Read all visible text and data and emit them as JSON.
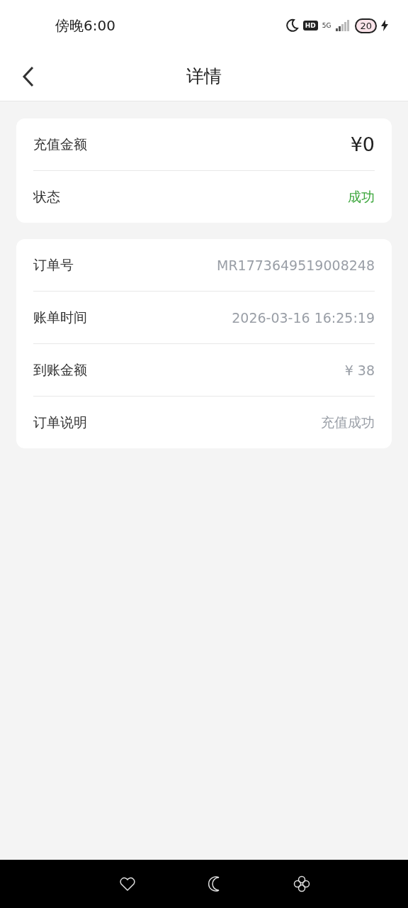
{
  "status_bar": {
    "time": "傍晚6:00",
    "hd": "HD",
    "network": "5G",
    "battery": "20",
    "charging": true
  },
  "header": {
    "title": "详情"
  },
  "cards": [
    {
      "rows": [
        {
          "label": "充值金额",
          "value": "¥0",
          "kind": "amount"
        },
        {
          "label": "状态",
          "value": "成功",
          "kind": "status"
        }
      ]
    },
    {
      "rows": [
        {
          "label": "订单号",
          "value": "MR1773649519008248",
          "kind": "plain"
        },
        {
          "label": "账单时间",
          "value": "2026-03-16 16:25:19",
          "kind": "plain"
        },
        {
          "label": "到账金额",
          "value": "¥ 38",
          "kind": "plain"
        },
        {
          "label": "订单说明",
          "value": "充值成功",
          "kind": "plain"
        }
      ]
    }
  ]
}
